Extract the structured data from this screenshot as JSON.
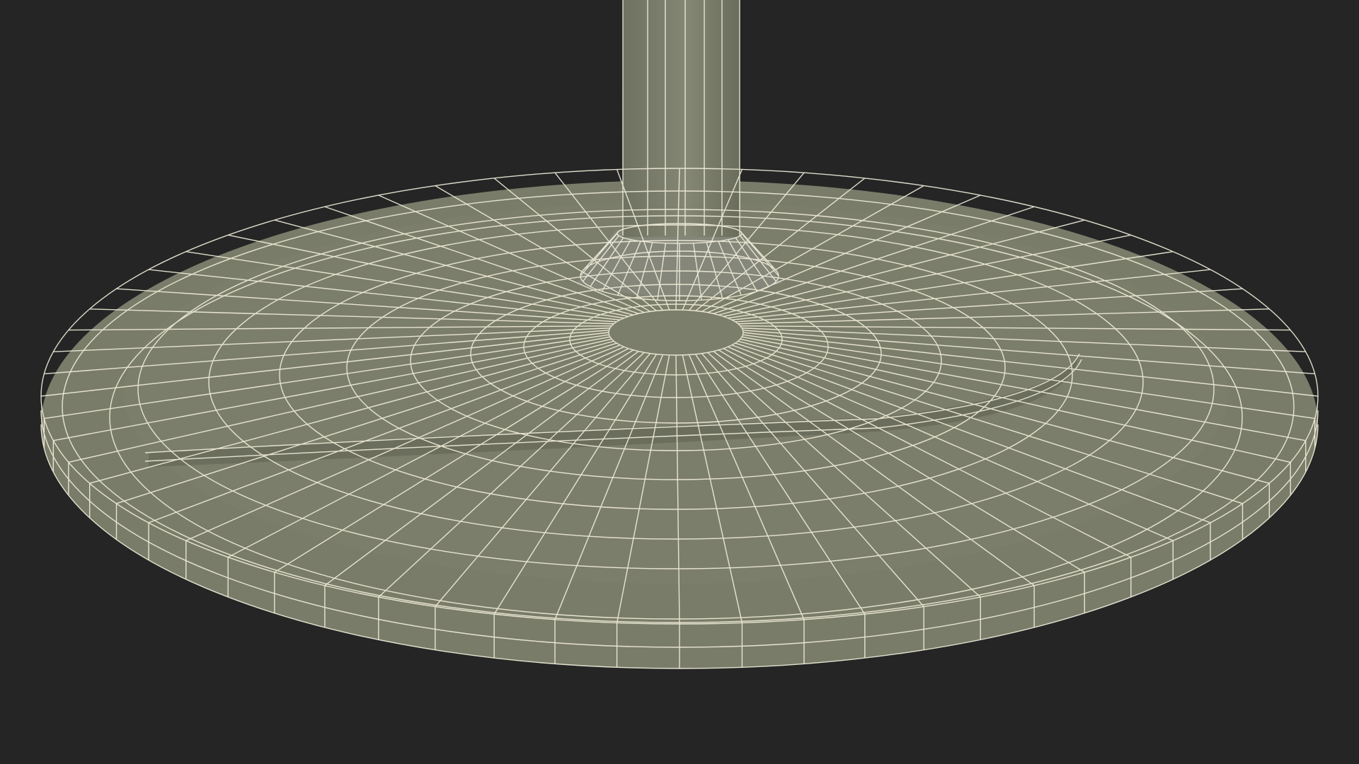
{
  "scene": {
    "subject": "wireframe-round-stand-base",
    "background_color": "#252525",
    "surface_color": "#7c7e6c",
    "surface_shadow_color": "#5f6152",
    "surface_highlight_color": "#8a8c7a",
    "wire_color": "#f3f0dd"
  }
}
